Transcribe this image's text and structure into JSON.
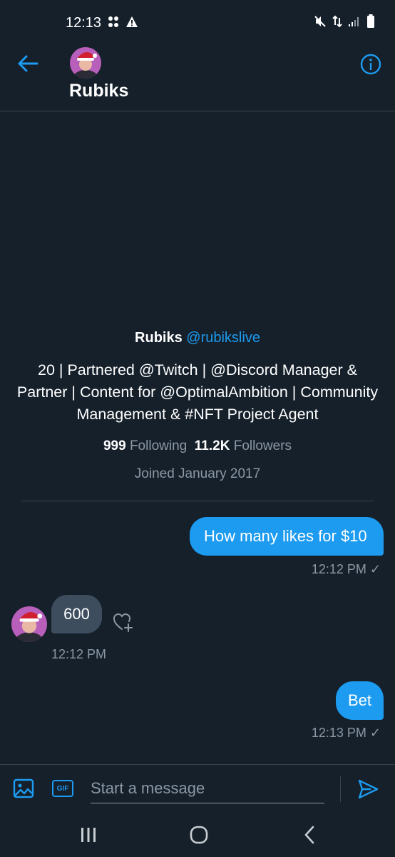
{
  "status_bar": {
    "time": "12:13"
  },
  "header": {
    "name": "Rubiks",
    "back_icon": "arrow-left-icon",
    "info_icon": "info-icon"
  },
  "profile": {
    "name": "Rubiks",
    "handle": "@rubikslive",
    "bio": "20 | Partnered @Twitch | @Discord Manager & Partner | Content for @OptimalAmbition | Community Management & #NFT Project Agent",
    "following_count": "999",
    "following_label": "Following",
    "followers_count": "11.2K",
    "followers_label": "Followers",
    "joined": "Joined January 2017"
  },
  "messages": [
    {
      "direction": "out",
      "text": "How many likes for $10",
      "time": "12:12 PM ✓"
    },
    {
      "direction": "in",
      "text": "600",
      "time": "12:12 PM"
    },
    {
      "direction": "out",
      "text": "Bet",
      "time": "12:13 PM ✓"
    }
  ],
  "composer": {
    "placeholder": "Start a message",
    "gif_label": "GIF"
  },
  "colors": {
    "background": "#15202b",
    "accent": "#1d9bf0",
    "incoming_bubble": "#3d4d5d",
    "secondary_text": "#8b98a5"
  }
}
